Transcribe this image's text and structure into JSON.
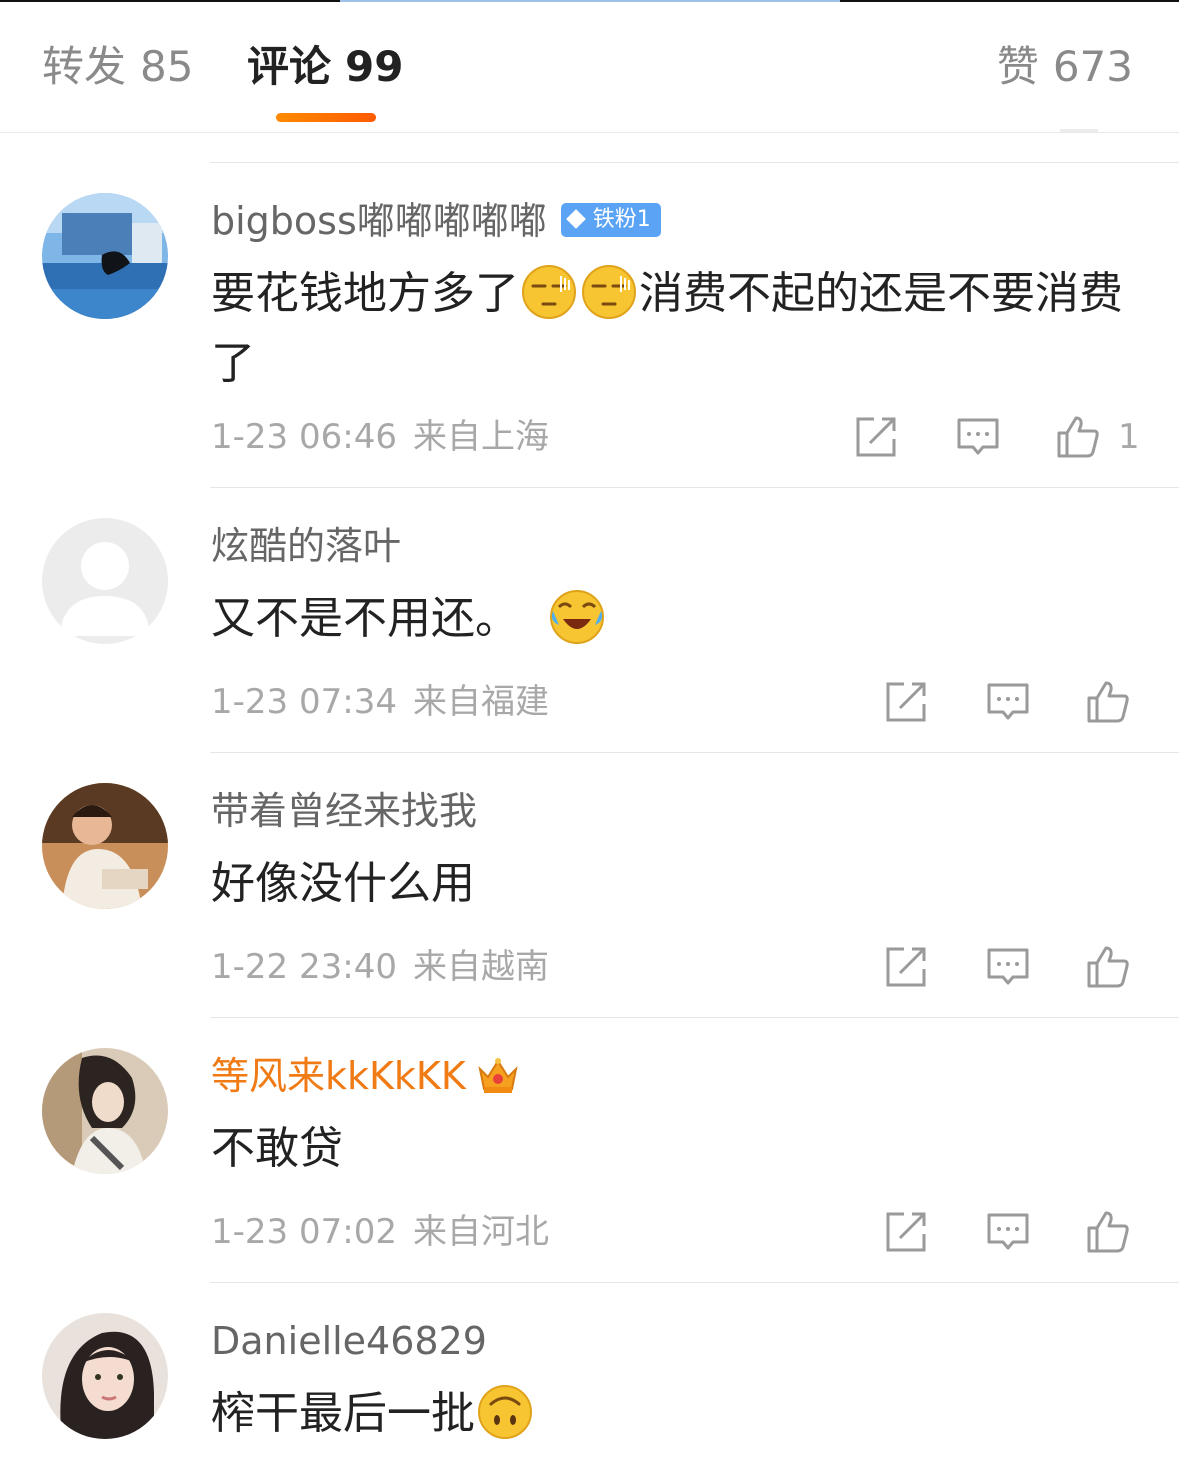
{
  "tabs": {
    "repost_label": "转发",
    "repost_count": "85",
    "comments_label": "评论",
    "comments_count": "99",
    "likes_label": "赞",
    "likes_count": "673"
  },
  "comments": [
    {
      "username": "bigboss嘟嘟嘟嘟嘟",
      "badge": "铁粉1",
      "text_before_emoji": "要花钱地方多了",
      "emojis": [
        "smirk-emoji",
        "smirk-emoji"
      ],
      "text_after_emoji": "消费不起的还是不要消费了",
      "time": "1-23 06:46",
      "location": "来自上海",
      "like_count": "1"
    },
    {
      "username": "炫酷的落叶",
      "text_before_emoji": "又不是不用还。",
      "emojis": [
        "laugh-cry-emoji"
      ],
      "time": "1-23 07:34",
      "location": "来自福建"
    },
    {
      "username": "带着曾经来找我",
      "text_before_emoji": "好像没什么用",
      "time": "1-22 23:40",
      "location": "来自越南"
    },
    {
      "username": "等风来kkKkKK",
      "name_color": "#f07a14",
      "text_before_emoji": "不敢贷",
      "time": "1-23 07:02",
      "location": "来自河北"
    },
    {
      "username": "Danielle46829",
      "text_before_emoji": "榨干最后一批",
      "emojis": [
        "upside-down-face-emoji"
      ]
    }
  ],
  "colors": {
    "accent": "#ff7a00",
    "vip_name": "#f07a14",
    "badge": "#5aa3f5",
    "meta": "#a8a8a8"
  },
  "icons": [
    "share-icon",
    "reply-icon",
    "thumbs-up-icon"
  ]
}
